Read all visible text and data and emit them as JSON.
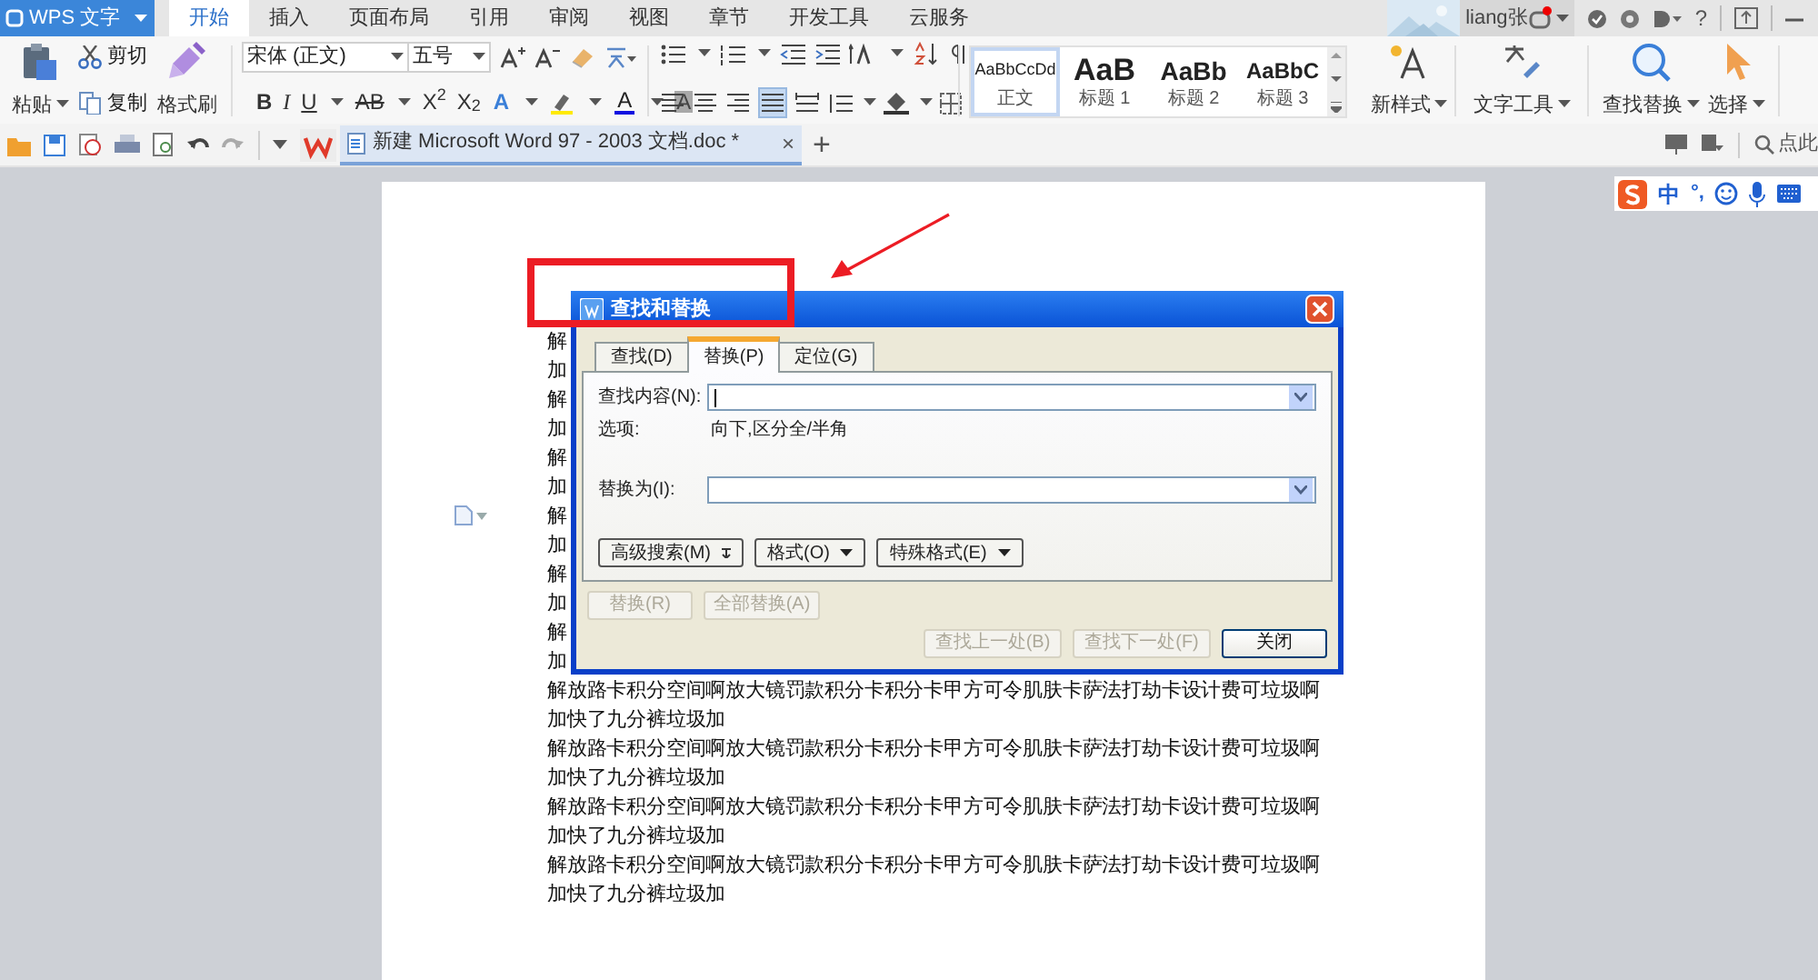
{
  "app_button": {
    "label": "WPS 文字"
  },
  "menu_tabs": [
    {
      "label": "开始",
      "selected": true
    },
    {
      "label": "插入",
      "selected": false
    },
    {
      "label": "页面布局",
      "selected": false
    },
    {
      "label": "引用",
      "selected": false
    },
    {
      "label": "审阅",
      "selected": false
    },
    {
      "label": "视图",
      "selected": false
    },
    {
      "label": "章节",
      "selected": false
    },
    {
      "label": "开发工具",
      "selected": false
    },
    {
      "label": "云服务",
      "selected": false
    }
  ],
  "user": {
    "name": "liang张",
    "help": "?"
  },
  "ribbon": {
    "paste": "粘贴",
    "cut": "剪切",
    "copy": "复制",
    "format_painter": "格式刷",
    "font_family": "宋体 (正文)",
    "font_size": "五号",
    "format_buttons": [
      {
        "label": "B",
        "kind": "bold"
      },
      {
        "label": "I",
        "kind": "italic"
      },
      {
        "label": "U",
        "kind": "underline"
      },
      {
        "label": "AB",
        "kind": "strike"
      },
      {
        "label": "X$^{2}$",
        "kind": "plain"
      },
      {
        "label": "X$_{2}$",
        "kind": "plain"
      }
    ],
    "color_buttons": [
      {
        "label": "A",
        "kind": "effect",
        "color": "#3a7fd8"
      },
      {
        "label": "A",
        "kind": "font_color",
        "color": "#1010e0"
      },
      {
        "label": "A",
        "kind": "shading",
        "color": "#a8a8a8"
      }
    ],
    "alignment": [
      {
        "kind": "left",
        "selected": false
      },
      {
        "kind": "center",
        "selected": false
      },
      {
        "kind": "right",
        "selected": false
      },
      {
        "kind": "justify",
        "selected": true
      },
      {
        "kind": "distributed",
        "selected": false
      }
    ],
    "styles": [
      {
        "sample": "AaBbCcDd",
        "label": "正文",
        "kind": "body",
        "selected": true
      },
      {
        "sample": "AaB",
        "label": "标题 1",
        "kind": "h1",
        "selected": false
      },
      {
        "sample": "AaBb",
        "label": "标题 2",
        "kind": "h2",
        "selected": false
      },
      {
        "sample": "AaBbC",
        "label": "标题 3",
        "kind": "h3",
        "selected": false
      }
    ],
    "new_style": "新样式",
    "text_tools": "文字工具",
    "find_replace": "查找替换",
    "select": "选择"
  },
  "doc_tab": {
    "title": "新建 Microsoft Word 97 - 2003 文档.doc *",
    "close": "×",
    "new": "+"
  },
  "search_hint": "点此",
  "ime": {
    "mode": "中",
    "punct": "°,"
  },
  "document": {
    "lines": [
      "解",
      "加",
      "解",
      "加",
      "解",
      "加",
      "解",
      "加",
      "解",
      "加",
      "解",
      "加",
      "解放路卡积分空间啊放大镜罚款积分卡积分卡甲方可令肌肤卡萨法打劫卡设计费可垃圾啊",
      "加快了九分裤垃圾加",
      "解放路卡积分空间啊放大镜罚款积分卡积分卡甲方可令肌肤卡萨法打劫卡设计费可垃圾啊",
      "加快了九分裤垃圾加",
      "解放路卡积分空间啊放大镜罚款积分卡积分卡甲方可令肌肤卡萨法打劫卡设计费可垃圾啊",
      "加快了九分裤垃圾加",
      "解放路卡积分空间啊放大镜罚款积分卡积分卡甲方可令肌肤卡萨法打劫卡设计费可垃圾啊",
      "加快了九分裤垃圾加"
    ]
  },
  "dialog": {
    "title": "查找和替换",
    "tabs": [
      {
        "label": "查找(D)",
        "selected": false
      },
      {
        "label": "替换(P)",
        "selected": true
      },
      {
        "label": "定位(G)",
        "selected": false
      }
    ],
    "find_label": "查找内容(N):",
    "options_label": "选项:",
    "options_value": "向下,区分全/半角",
    "replace_label": "替换为(I):",
    "option_buttons": [
      {
        "label": "高级搜索(M)",
        "kind": "expand"
      },
      {
        "label": "格式(O)",
        "kind": "menu"
      },
      {
        "label": "特殊格式(E)",
        "kind": "menu"
      }
    ],
    "action_buttons": [
      {
        "label": "替换(R)",
        "disabled": true
      },
      {
        "label": "全部替换(A)",
        "disabled": true
      }
    ],
    "nav_buttons": [
      {
        "label": "查找上一处(B)",
        "disabled": true
      },
      {
        "label": "查找下一处(F)",
        "disabled": true
      },
      {
        "label": "关闭",
        "disabled": false
      }
    ]
  }
}
